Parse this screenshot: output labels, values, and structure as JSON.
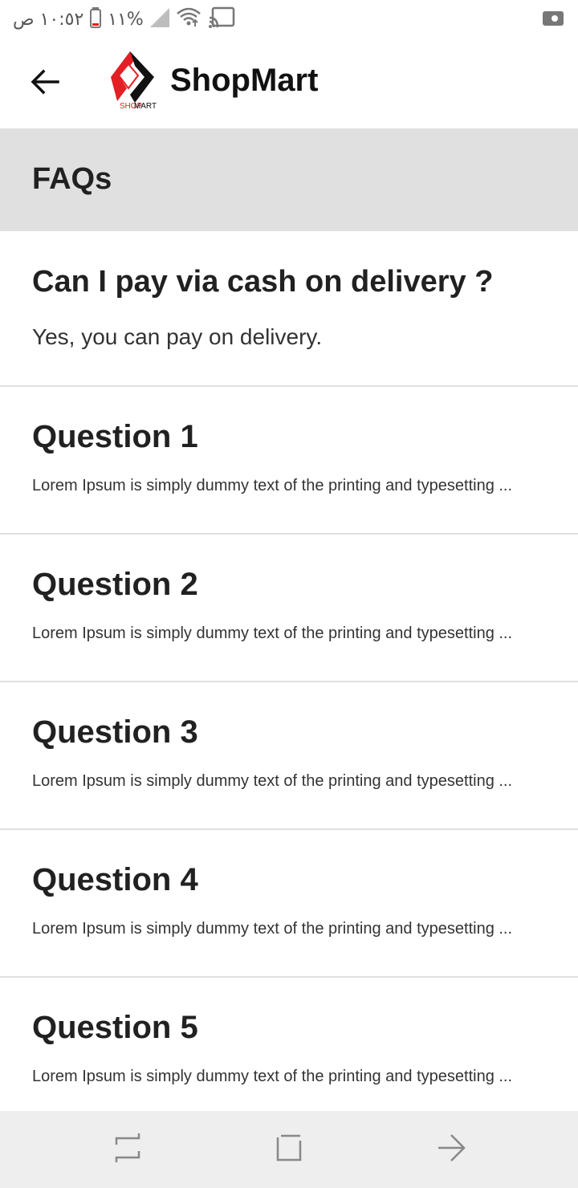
{
  "status_bar": {
    "time": "١٠:٥٢ ص",
    "battery_percent": "%١١"
  },
  "app_bar": {
    "title": "ShopMart",
    "logo_text": "SHOP MART",
    "back_icon": "arrow-back-icon"
  },
  "section": {
    "title": "FAQs"
  },
  "faqs": [
    {
      "question": "Can I pay via cash on delivery ?",
      "answer": "Yes, you can pay on delivery.",
      "expanded": true
    },
    {
      "question": "Question 1",
      "answer": "Lorem Ipsum is simply dummy text of the printing and typesetting ...",
      "expanded": false
    },
    {
      "question": "Question 2",
      "answer": "Lorem Ipsum is simply dummy text of the printing and typesetting ...",
      "expanded": false
    },
    {
      "question": "Question 3",
      "answer": "Lorem Ipsum is simply dummy text of the printing and typesetting ...",
      "expanded": false
    },
    {
      "question": "Question 4",
      "answer": "Lorem Ipsum is simply dummy text of the printing and typesetting ...",
      "expanded": false
    },
    {
      "question": "Question 5",
      "answer": "Lorem Ipsum is simply dummy text of the printing and typesetting ...",
      "expanded": false
    }
  ],
  "nav_bar": {
    "icons": [
      "recents-icon",
      "home-icon",
      "back-icon"
    ]
  },
  "colors": {
    "brand_red": "#e31e24",
    "header_gray": "#e0e0e0",
    "divider": "#e0e0e0",
    "nav_bg": "#eeeeee"
  }
}
